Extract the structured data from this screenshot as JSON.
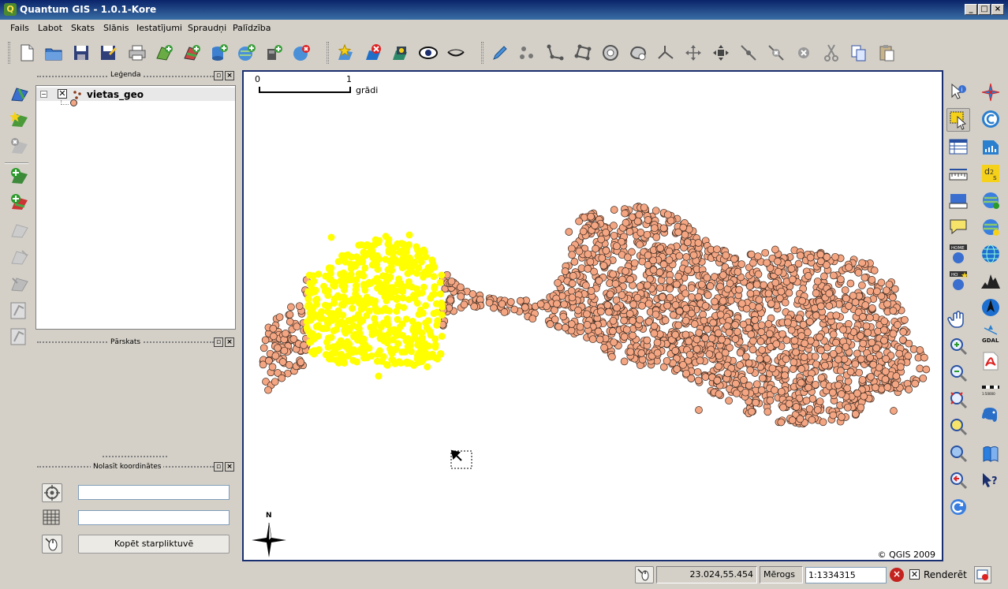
{
  "window": {
    "title": "Quantum GIS - 1.0.1-Kore"
  },
  "menu": [
    "Fails",
    "Labot",
    "Skats",
    "Slānis",
    "Iestatījumi",
    "Spraudņi",
    "Palīdzība"
  ],
  "legend": {
    "title": "Leģenda",
    "layer_name": "vietas_geo"
  },
  "overview": {
    "title": "Pārskats"
  },
  "coord_reader": {
    "title": "Nolasīt koordinātes",
    "field1_value": "",
    "field2_value": "",
    "copy_button": "Kopēt starpliktuvē"
  },
  "map": {
    "scalebar": {
      "start": "0",
      "end": "1",
      "unit": "grādi"
    },
    "north": "N",
    "copyright": "© QGIS 2009",
    "point_color": "#f4a582",
    "selected_color": "#ffff00"
  },
  "statusbar": {
    "coordinates": "23.024,55.454",
    "scale_label": "Mērogs",
    "scale_value": "1:1334315",
    "render_label": "Renderēt"
  },
  "colors": {
    "titlebar": "#0a246a",
    "map_border": "#1a2f6f"
  }
}
